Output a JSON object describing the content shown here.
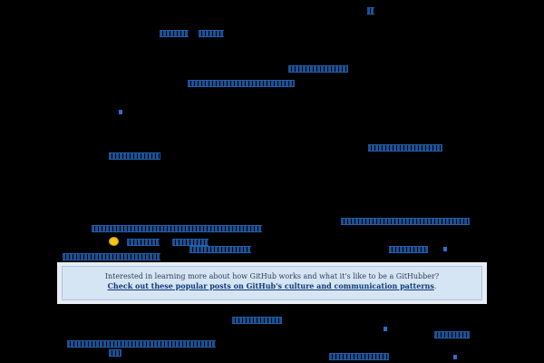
{
  "promo": {
    "question": "Interested in learning more about how GitHub works and what it's like to be a GitHubber?",
    "link_text": "Check out these popular posts on GitHub's culture and communication patterns",
    "trailing": "."
  },
  "colors": {
    "background": "#000000",
    "link": "#1f5fb0",
    "panel_outer": "#e8edf3",
    "panel_inner": "#d6e5f3",
    "panel_border": "#a9c6e3",
    "emoji": "#f5c518"
  },
  "icons": {
    "emoji": "smiley-emoji-icon"
  }
}
